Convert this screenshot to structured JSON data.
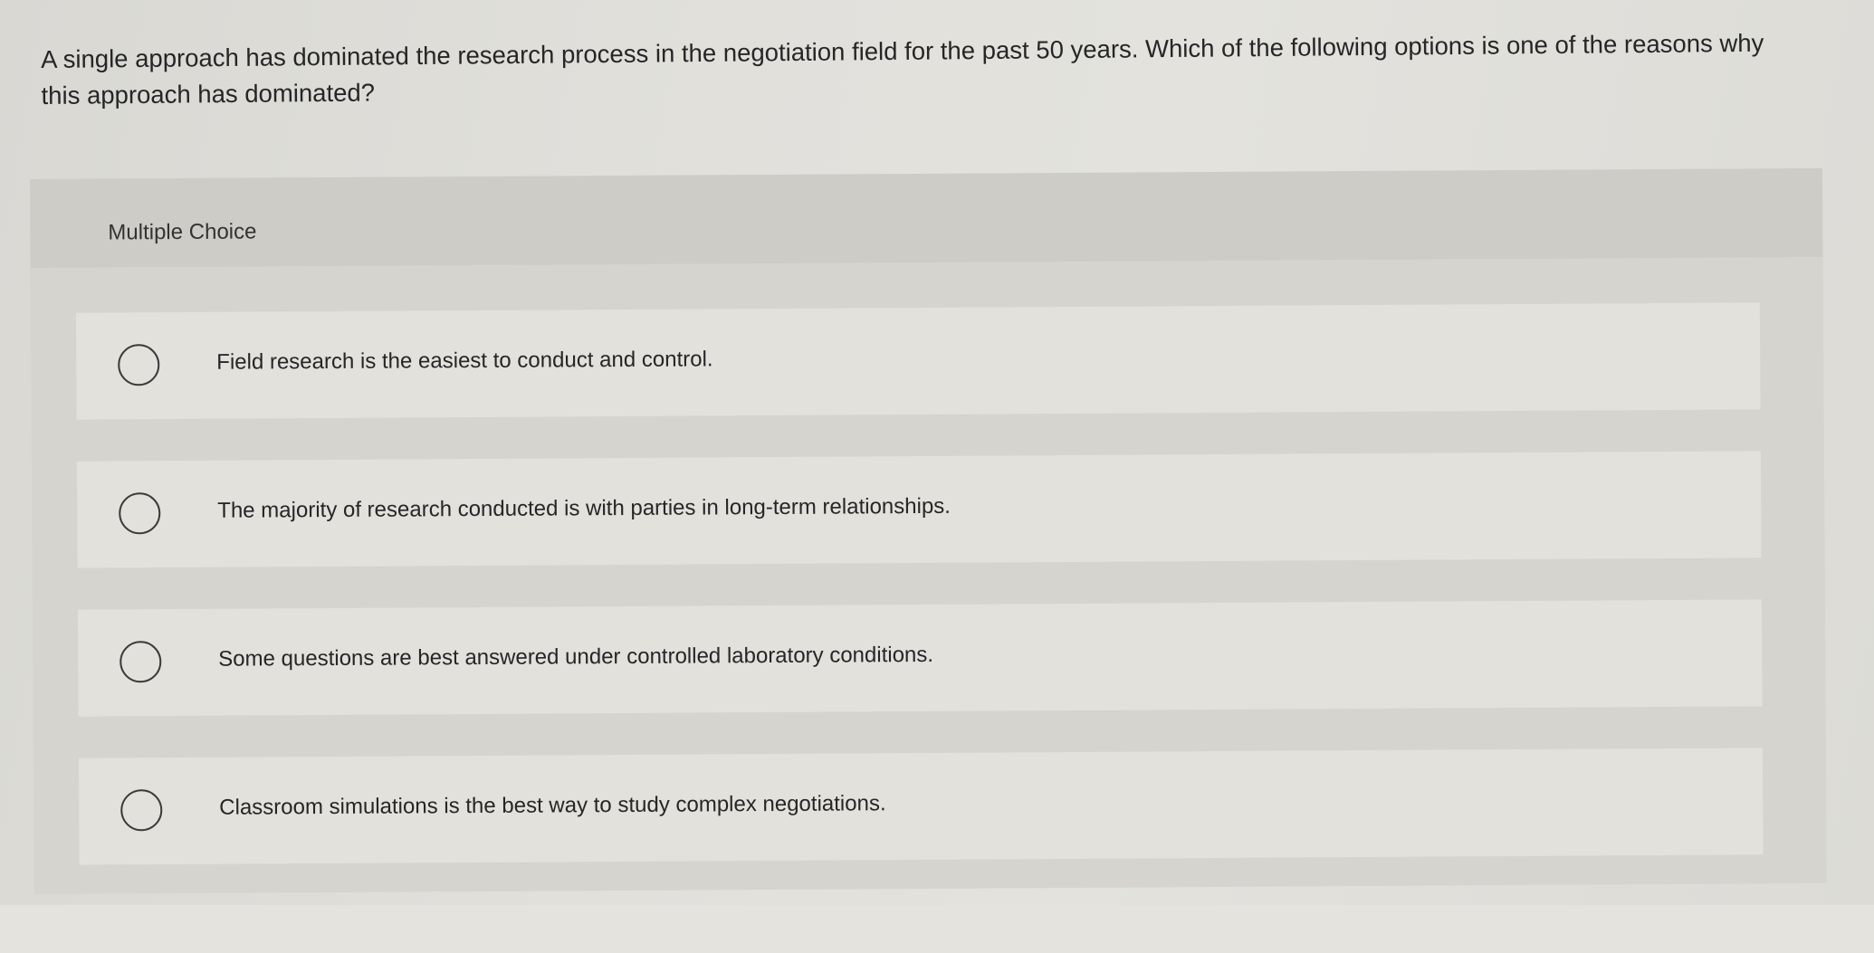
{
  "question": {
    "text": "A single approach has dominated the research process in the negotiation field for the past 50 years. Which of the following options is one of the reasons why this approach has dominated?"
  },
  "panel": {
    "label": "Multiple Choice"
  },
  "options": [
    {
      "text": "Field research is the easiest to conduct and control."
    },
    {
      "text": "The majority of research conducted is with parties in long-term relationships."
    },
    {
      "text": "Some questions are best answered under controlled laboratory conditions."
    },
    {
      "text": "Classroom simulations is the best way to study complex negotiations."
    }
  ],
  "colors": {
    "background": "#e1e0db",
    "panel": "#d5d4cf",
    "option_card": "#e2e1dc",
    "text": "#262626"
  },
  "icons": {
    "radio": "empty-radio-circle"
  }
}
